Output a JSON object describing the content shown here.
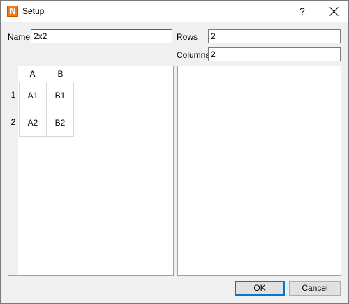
{
  "window": {
    "title": "Setup",
    "app_icon_letter": "N",
    "help_label": "?",
    "close_icon": "close-icon"
  },
  "form": {
    "name_label": "Name",
    "name_value": "2x2",
    "rows_label": "Rows",
    "rows_value": "2",
    "columns_label": "Columns",
    "columns_value": "2"
  },
  "grid": {
    "column_headers": [
      "A",
      "B"
    ],
    "row_headers": [
      "1",
      "2"
    ],
    "cells": [
      [
        "A1",
        "B1"
      ],
      [
        "A2",
        "B2"
      ]
    ]
  },
  "buttons": {
    "ok_label": "OK",
    "cancel_label": "Cancel"
  },
  "colors": {
    "accent": "#0078d7",
    "app_icon": "#f07c1c"
  }
}
